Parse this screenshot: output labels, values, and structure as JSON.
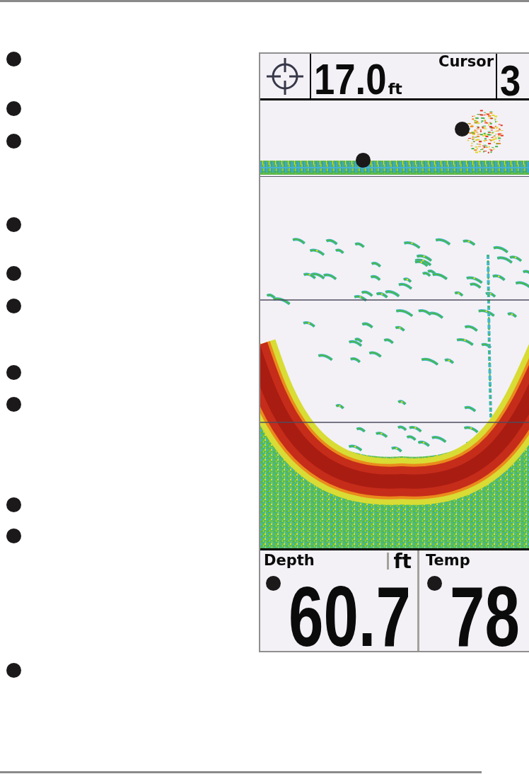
{
  "sonar_screen": {
    "cursor_depth": {
      "value": "17.0",
      "unit": "ft",
      "label": "Cursor"
    },
    "column_3": {
      "value": "3"
    },
    "readouts": [
      {
        "label": "Depth",
        "unit": "ft",
        "value": "60.7"
      },
      {
        "label": "Temp",
        "value": "78"
      }
    ]
  }
}
